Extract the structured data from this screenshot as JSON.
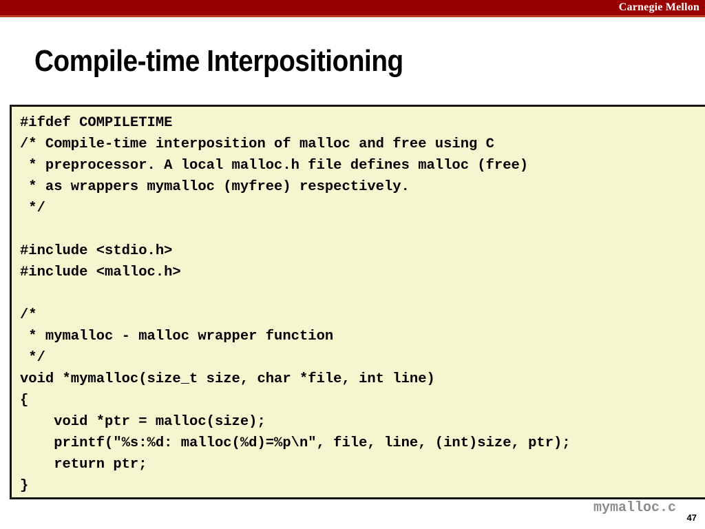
{
  "banner": {
    "brand": "Carnegie Mellon",
    "color": "#990000",
    "underline_color": "#c23b24"
  },
  "slide": {
    "title": "Compile-time Interpositioning",
    "number": "47",
    "file_label": "mymalloc.c",
    "file_label_color": "#8c8c8c"
  },
  "code_block": {
    "background": "#f5f5d0",
    "border_color": "#151512",
    "language": "c",
    "lines": [
      "#ifdef COMPILETIME",
      "/* Compile-time interposition of malloc and free using C",
      " * preprocessor. A local malloc.h file defines malloc (free)",
      " * as wrappers mymalloc (myfree) respectively.",
      " */",
      "",
      "#include <stdio.h>",
      "#include <malloc.h>",
      "",
      "/*",
      " * mymalloc - malloc wrapper function",
      " */",
      "void *mymalloc(size_t size, char *file, int line)",
      "{",
      "    void *ptr = malloc(size);",
      "    printf(\"%s:%d: malloc(%d)=%p\\n\", file, line, (int)size, ptr);",
      "    return ptr;",
      "}"
    ]
  }
}
